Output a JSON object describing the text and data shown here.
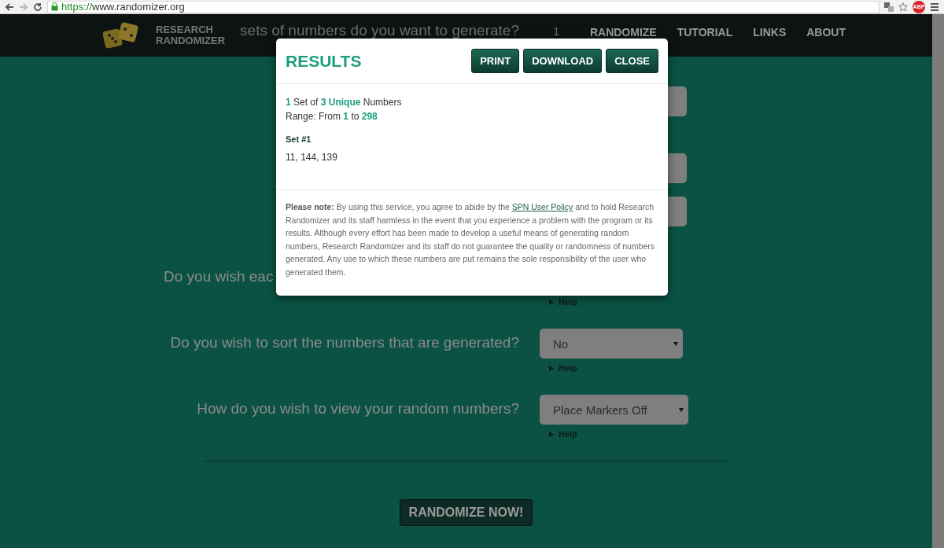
{
  "browser": {
    "url_scheme": "https://",
    "url_host": "www.randomizer.org",
    "extension_badge": "ABP"
  },
  "header": {
    "logo_line_1": "RESEARCH",
    "logo_line_2": "RANDOMIZER",
    "nav": [
      {
        "label": "RANDOMIZE"
      },
      {
        "label": "TUTORIAL"
      },
      {
        "label": "LINKS"
      },
      {
        "label": "ABOUT"
      }
    ]
  },
  "form": {
    "rows": [
      {
        "kind": "header_field",
        "question": "sets of numbers do you want to generate?",
        "value": "1"
      },
      {
        "kind": "edge_field"
      },
      {
        "kind": "edge_field"
      },
      {
        "kind": "edge_field"
      },
      {
        "kind": "covered",
        "question": "Do you wish eac",
        "help": "Help"
      },
      {
        "kind": "select",
        "question": "Do you wish to sort the numbers that are generated?",
        "value": "No",
        "help": "Help"
      },
      {
        "kind": "select",
        "question": "How do you wish to view your random numbers?",
        "value": "Place Markers Off",
        "help": "Help"
      }
    ],
    "submit": "RANDOMIZE NOW!"
  },
  "results_dialog": {
    "title": "RESULTS",
    "buttons": [
      "PRINT",
      "DOWNLOAD",
      "CLOSE"
    ],
    "summary": [
      "**1** Set of **3 Unique** Numbers",
      "Range: From **1** to **298**"
    ],
    "sets": [
      {
        "heading": "Set #1",
        "numbers": "11, 144, 139"
      }
    ],
    "note": {
      "before": "**Please note:** By using this service, you agree to abide by the ",
      "link": "SPN User Policy",
      "after": " and to hold Research Randomizer and its staff harmless in the event that you experience a problem with the program or its results. Although every effort has been made to develop a useful means of generating random numbers, Research Randomizer and its staff do not guarantee the quality or randomness of numbers generated. Any use to which these numbers are put remains the sole responsibility of the user who generated them."
    }
  }
}
